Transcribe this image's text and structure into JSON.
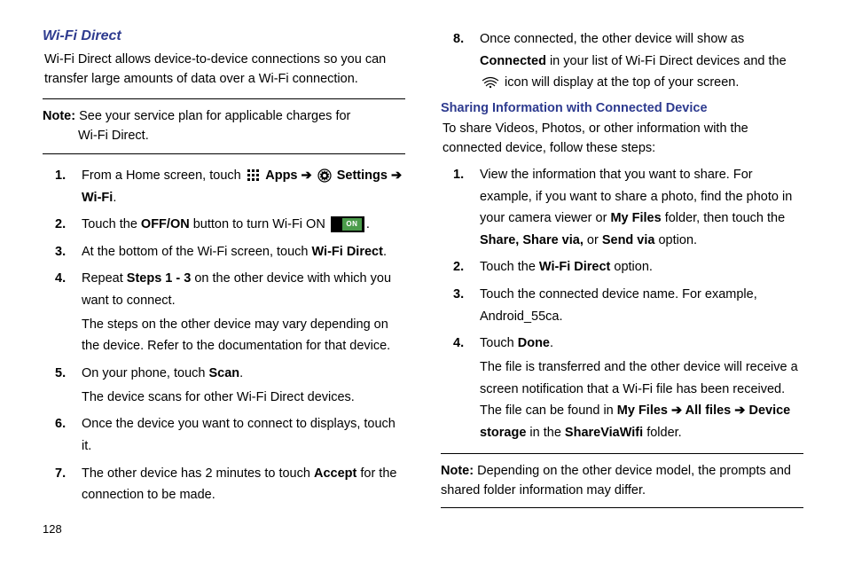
{
  "pageNumber": "128",
  "left": {
    "title": "Wi-Fi Direct",
    "intro": "Wi-Fi Direct allows device-to-device connections so you can transfer large amounts of data over a Wi-Fi connection.",
    "noteLabel": "Note:",
    "noteLine1": " See your service plan for applicable charges for",
    "noteLine2": "Wi-Fi Direct.",
    "steps": {
      "s1a": "From a Home screen, touch ",
      "apps": " Apps ",
      "arrow1": "➔ ",
      "settings": " Settings ",
      "arrow2": "➔ ",
      "wifi": "Wi-Fi",
      "s1end": ".",
      "s2a": "Touch the ",
      "s2b": "OFF/ON",
      "s2c": " button to turn Wi-Fi ON ",
      "s2end": ".",
      "s3a": "At the bottom of the Wi-Fi screen, touch ",
      "s3b": "Wi-Fi Direct",
      "s3end": ".",
      "s4a": "Repeat ",
      "s4b": "Steps 1 - 3",
      "s4c": " on the other device with which you want to connect.",
      "s4note": "The steps on the other device may vary depending on the device. Refer to the documentation for that device.",
      "s5a": "On your phone, touch ",
      "s5b": "Scan",
      "s5end": ".",
      "s5note": "The device scans for other Wi-Fi Direct devices.",
      "s6": "Once the device you want to connect to displays, touch it.",
      "s7a": "The other device has 2 minutes to touch ",
      "s7b": "Accept",
      "s7c": " for the connection to be made."
    }
  },
  "right": {
    "s8a": "Once connected, the other device will show as ",
    "s8b": "Connected",
    "s8c": " in your list of Wi-Fi Direct devices and the ",
    "s8d": " icon will display at the top of your screen.",
    "subheading": "Sharing Information with Connected Device",
    "shareIntro": "To share Videos, Photos, or other information with the connected device, follow these steps:",
    "steps": {
      "s1a": "View the information that you want to share. For example, if you want to share a photo, find the photo in your camera viewer or ",
      "s1b": "My Files",
      "s1c": " folder, then touch the ",
      "s1d": "Share, Share via,",
      "s1e": " or ",
      "s1f": "Send via",
      "s1g": " option.",
      "s2a": "Touch the ",
      "s2b": "Wi-Fi Direct",
      "s2c": " option.",
      "s3": "Touch the connected device name. For example, Android_55ca.",
      "s4a": "Touch ",
      "s4b": "Done",
      "s4c": ".",
      "s4note_a": "The file is transferred and the other device will receive a screen notification that a Wi-Fi file has been received. The file can be found in ",
      "s4note_b": "My Files ",
      "s4note_arr1": "➔ ",
      "s4note_c": "All files ",
      "s4note_arr2": "➔ ",
      "s4note_d": "Device storage",
      "s4note_e": " in the ",
      "s4note_f": "ShareViaWifi",
      "s4note_g": " folder."
    },
    "noteLabel": "Note:",
    "noteText": " Depending on the other device model, the prompts and shared folder information may differ."
  }
}
